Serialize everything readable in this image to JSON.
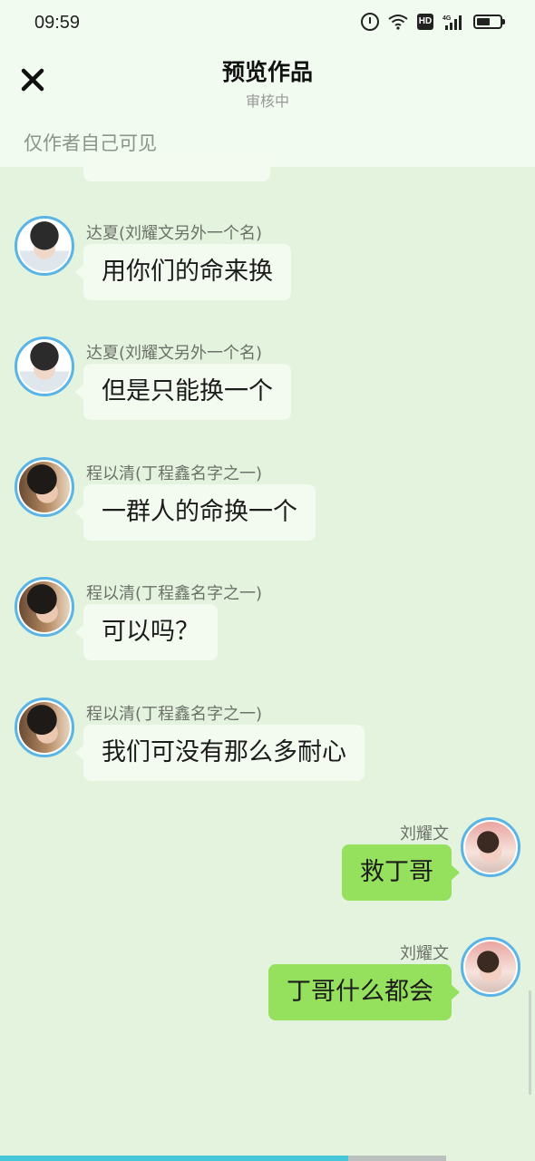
{
  "status_bar": {
    "time": "09:59",
    "icons": [
      "alarm-icon",
      "wifi-icon",
      "hd-icon",
      "signal-4g-icon",
      "battery-icon"
    ],
    "hd_label": "HD",
    "network_label": "4G"
  },
  "header": {
    "close_icon": "close-icon",
    "title": "预览作品",
    "subtitle": "审核中",
    "visibility_note": "仅作者自己可见"
  },
  "messages": [
    {
      "side": "left",
      "sender": "达夏(刘耀文另外一个名)",
      "text": "用你们的命来换",
      "avatar": "avatar-a"
    },
    {
      "side": "left",
      "sender": "达夏(刘耀文另外一个名)",
      "text": "但是只能换一个",
      "avatar": "avatar-a"
    },
    {
      "side": "left",
      "sender": "程以清(丁程鑫名字之一)",
      "text": "一群人的命换一个",
      "avatar": "avatar-b"
    },
    {
      "side": "left",
      "sender": "程以清(丁程鑫名字之一)",
      "text": "可以吗？",
      "avatar": "avatar-b"
    },
    {
      "side": "left",
      "sender": "程以清(丁程鑫名字之一)",
      "text": "我们可没有那么多耐心",
      "avatar": "avatar-b"
    },
    {
      "side": "right",
      "sender": "刘耀文",
      "text": "救丁哥",
      "avatar": "avatar-c"
    },
    {
      "side": "right",
      "sender": "刘耀文",
      "text": "丁哥什么都会",
      "avatar": "avatar-c"
    }
  ],
  "playback": {
    "progress": 0.78
  },
  "colors": {
    "background": "#e4f3de",
    "header_bg": "#f1fbef",
    "bubble_left": "#f3faf0",
    "bubble_right": "#95e05c",
    "avatar_ring": "#5ab4e6",
    "progress": "#45c6d6"
  }
}
